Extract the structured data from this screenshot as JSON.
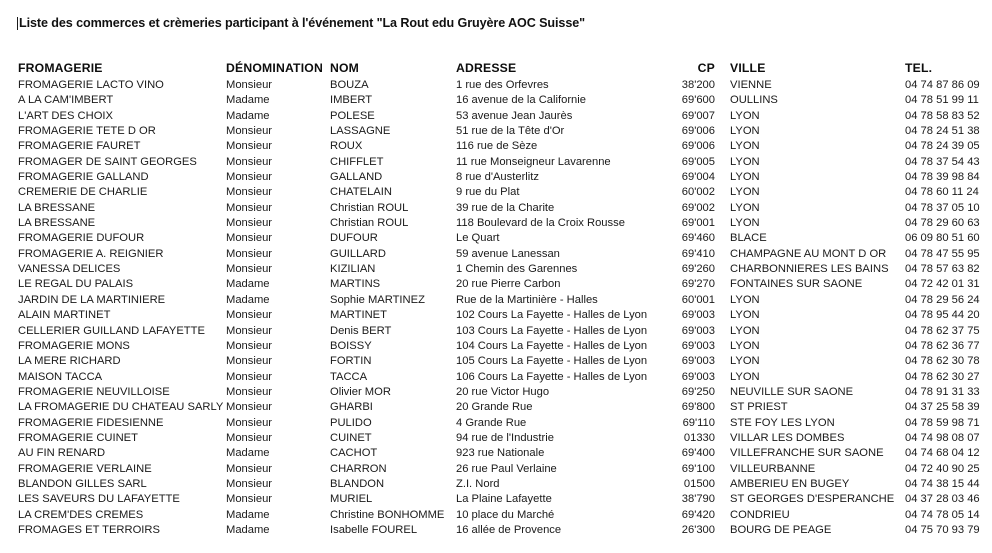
{
  "document": {
    "title": "Liste des commerces et crèmeries participant à l'événement \"La Rout edu Gruyère AOC Suisse\""
  },
  "table": {
    "headers": {
      "fromagerie": "FROMAGERIE",
      "denomination": "DÉNOMINATION",
      "nom": "NOM",
      "adresse": "ADRESSE",
      "cp": "CP",
      "ville": "VILLE",
      "tel": "TEL."
    },
    "rows": [
      {
        "fromagerie": "FROMAGERIE LACTO VINO",
        "denomination": "Monsieur",
        "nom": "BOUZA",
        "adresse": "1 rue des Orfevres",
        "cp": "38'200",
        "ville": "VIENNE",
        "tel": "04 74 87 86 09"
      },
      {
        "fromagerie": "A LA CAM'IMBERT",
        "denomination": "Madame",
        "nom": "IMBERT",
        "adresse": "16 avenue de la Californie",
        "cp": "69'600",
        "ville": "OULLINS",
        "tel": "04 78 51 99 11"
      },
      {
        "fromagerie": "L'ART DES CHOIX",
        "denomination": "Madame",
        "nom": "POLESE",
        "adresse": "53 avenue Jean Jaurès",
        "cp": "69'007",
        "ville": "LYON",
        "tel": "04 78 58 83 52"
      },
      {
        "fromagerie": "FROMAGERIE TETE D OR",
        "denomination": "Monsieur",
        "nom": "LASSAGNE",
        "adresse": "51 rue de la Tête d'Or",
        "cp": "69'006",
        "ville": "LYON",
        "tel": "04 78 24 51 38"
      },
      {
        "fromagerie": "FROMAGERIE FAURET",
        "denomination": "Monsieur",
        "nom": "ROUX",
        "adresse": "116 rue de Sèze",
        "cp": "69'006",
        "ville": "LYON",
        "tel": "04 78 24 39 05"
      },
      {
        "fromagerie": "FROMAGER DE SAINT GEORGES",
        "denomination": "Monsieur",
        "nom": "CHIFFLET",
        "adresse": "11 rue Monseigneur Lavarenne",
        "cp": "69'005",
        "ville": "LYON",
        "tel": "04 78 37 54 43"
      },
      {
        "fromagerie": "FROMAGERIE GALLAND",
        "denomination": "Monsieur",
        "nom": "GALLAND",
        "adresse": "8 rue d'Austerlitz",
        "cp": "69'004",
        "ville": "LYON",
        "tel": "04 78 39 98 84"
      },
      {
        "fromagerie": "CREMERIE DE CHARLIE",
        "denomination": "Monsieur",
        "nom": "CHATELAIN",
        "adresse": "9 rue du Plat",
        "cp": "60'002",
        "ville": "LYON",
        "tel": "04 78 60 11 24"
      },
      {
        "fromagerie": "LA BRESSANE",
        "denomination": "Monsieur",
        "nom": "Christian ROUL",
        "adresse": "39 rue de la Charite",
        "cp": "69'002",
        "ville": "LYON",
        "tel": "04 78 37 05 10"
      },
      {
        "fromagerie": "LA BRESSANE",
        "denomination": "Monsieur",
        "nom": "Christian ROUL",
        "adresse": "118 Boulevard de la Croix Rousse",
        "cp": "69'001",
        "ville": "LYON",
        "tel": "04 78 29 60 63"
      },
      {
        "fromagerie": "FROMAGERIE DUFOUR",
        "denomination": "Monsieur",
        "nom": "DUFOUR",
        "adresse": "Le Quart",
        "cp": "69'460",
        "ville": "BLACE",
        "tel": "06 09 80 51 60"
      },
      {
        "fromagerie": "FROMAGERIE A. REIGNIER",
        "denomination": "Monsieur",
        "nom": "GUILLARD",
        "adresse": "59 avenue Lanessan",
        "cp": "69'410",
        "ville": "CHAMPAGNE AU MONT D OR",
        "tel": "04 78 47 55 95"
      },
      {
        "fromagerie": "VANESSA DELICES",
        "denomination": "Monsieur",
        "nom": "KIZILIAN",
        "adresse": "1 Chemin des Garennes",
        "cp": "69'260",
        "ville": "CHARBONNIERES LES BAINS",
        "tel": "04 78 57 63 82"
      },
      {
        "fromagerie": "LE REGAL DU PALAIS",
        "denomination": "Madame",
        "nom": "MARTINS",
        "adresse": "20 rue Pierre Carbon",
        "cp": "69'270",
        "ville": "FONTAINES SUR SAONE",
        "tel": "04 72 42 01 31"
      },
      {
        "fromagerie": "JARDIN DE LA MARTINIERE",
        "denomination": "Madame",
        "nom": "Sophie MARTINEZ",
        "adresse": "Rue de la Martinière - Halles",
        "cp": "60'001",
        "ville": "LYON",
        "tel": "04 78 29 56 24"
      },
      {
        "fromagerie": "ALAIN MARTINET",
        "denomination": "Monsieur",
        "nom": "MARTINET",
        "adresse": "102 Cours La Fayette - Halles de Lyon",
        "cp": "69'003",
        "ville": "LYON",
        "tel": "04 78 95 44 20"
      },
      {
        "fromagerie": "CELLERIER GUILLAND LAFAYETTE",
        "denomination": "Monsieur",
        "nom": "Denis BERT",
        "adresse": "103 Cours La Fayette - Halles de Lyon",
        "cp": "69'003",
        "ville": "LYON",
        "tel": "04 78 62 37 75"
      },
      {
        "fromagerie": "FROMAGERIE MONS",
        "denomination": "Monsieur",
        "nom": "BOISSY",
        "adresse": "104 Cours La Fayette - Halles de Lyon",
        "cp": "69'003",
        "ville": "LYON",
        "tel": "04 78 62 36 77"
      },
      {
        "fromagerie": "LA MERE RICHARD",
        "denomination": "Monsieur",
        "nom": "FORTIN",
        "adresse": "105 Cours La Fayette - Halles de Lyon",
        "cp": "69'003",
        "ville": "LYON",
        "tel": "04 78 62 30 78"
      },
      {
        "fromagerie": "MAISON TACCA",
        "denomination": "Monsieur",
        "nom": "TACCA",
        "adresse": "106 Cours La Fayette - Halles de Lyon",
        "cp": "69'003",
        "ville": "LYON",
        "tel": "04 78 62 30 27"
      },
      {
        "fromagerie": "FROMAGERIE NEUVILLOISE",
        "denomination": "Monsieur",
        "nom": "Olivier MOR",
        "adresse": "20 rue Victor Hugo",
        "cp": "69'250",
        "ville": "NEUVILLE SUR SAONE",
        "tel": "04 78 91 31 33"
      },
      {
        "fromagerie": "LA FROMAGERIE DU CHATEAU SARLY",
        "denomination": "Monsieur",
        "nom": "GHARBI",
        "adresse": "20 Grande Rue",
        "cp": "69'800",
        "ville": "ST PRIEST",
        "tel": "04 37 25 58 39"
      },
      {
        "fromagerie": "FROMAGERIE FIDESIENNE",
        "denomination": "Monsieur",
        "nom": "PULIDO",
        "adresse": "4 Grande Rue",
        "cp": "69'110",
        "ville": "STE FOY LES LYON",
        "tel": "04 78 59 98 71"
      },
      {
        "fromagerie": "FROMAGERIE CUINET",
        "denomination": "Monsieur",
        "nom": "CUINET",
        "adresse": "94 rue de l'Industrie",
        "cp": "01330",
        "ville": "VILLAR LES DOMBES",
        "tel": "04 74 98 08 07"
      },
      {
        "fromagerie": "AU FIN RENARD",
        "denomination": "Madame",
        "nom": "CACHOT",
        "adresse": "923 rue Nationale",
        "cp": "69'400",
        "ville": "VILLEFRANCHE SUR SAONE",
        "tel": "04 74 68 04 12"
      },
      {
        "fromagerie": "FROMAGERIE VERLAINE",
        "denomination": "Monsieur",
        "nom": "CHARRON",
        "adresse": "26 rue Paul Verlaine",
        "cp": "69'100",
        "ville": "VILLEURBANNE",
        "tel": "04 72 40 90 25"
      },
      {
        "fromagerie": "BLANDON GILLES SARL",
        "denomination": "Monsieur",
        "nom": "BLANDON",
        "adresse": "Z.I. Nord",
        "cp": "01500",
        "ville": "AMBERIEU EN BUGEY",
        "tel": "04 74 38 15 44"
      },
      {
        "fromagerie": "LES SAVEURS DU LAFAYETTE",
        "denomination": "Monsieur",
        "nom": "MURIEL",
        "adresse": "La Plaine Lafayette",
        "cp": "38'790",
        "ville": "ST GEORGES D'ESPERANCHE",
        "tel": "04 37 28 03 46"
      },
      {
        "fromagerie": "LA CREM'DES CREMES",
        "denomination": "Madame",
        "nom": "Christine BONHOMME",
        "adresse": "10 place du Marché",
        "cp": "69'420",
        "ville": "CONDRIEU",
        "tel": "04 74 78 05 14"
      },
      {
        "fromagerie": "FROMAGES ET TERROIRS",
        "denomination": "Madame",
        "nom": "Isabelle FOUREL",
        "adresse": "16 allée de Provence",
        "cp": "26'300",
        "ville": "BOURG DE PEAGE",
        "tel": "04 75 70 93 79"
      }
    ]
  }
}
